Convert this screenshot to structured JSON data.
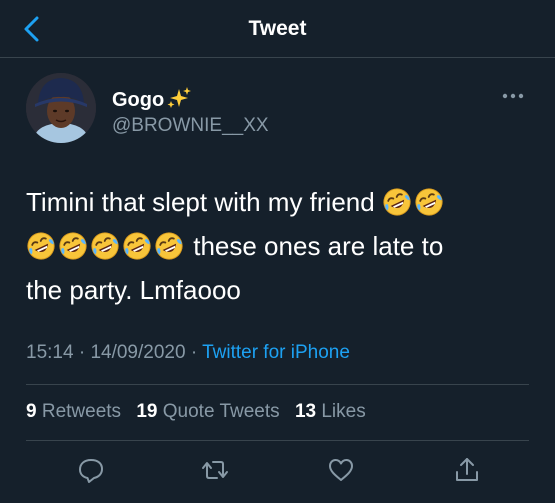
{
  "header": {
    "title": "Tweet",
    "back_icon": "chevron-left-icon"
  },
  "author": {
    "name": "Gogo",
    "name_emoji": "sparkles",
    "handle": "@BROWNIE__XX"
  },
  "tweet": {
    "line1_text": "Timini that slept with my friend",
    "line2_text": "these ones are late to",
    "line3_text": "the party. Lmfaooo",
    "emoji_name": "rolling-on-the-floor-laughing"
  },
  "meta": {
    "time": "15:14",
    "date": "14/09/2020",
    "source": "Twitter for iPhone",
    "separator": "·"
  },
  "stats": {
    "retweets_count": "9",
    "retweets_label": "Retweets",
    "quotes_count": "19",
    "quotes_label": "Quote Tweets",
    "likes_count": "13",
    "likes_label": "Likes"
  },
  "actions": [
    "reply-icon",
    "retweet-icon",
    "like-icon",
    "share-icon"
  ],
  "colors": {
    "background": "#15202b",
    "accent": "#1da1f2",
    "secondary_text": "#8899a6",
    "divider": "#38444d"
  }
}
